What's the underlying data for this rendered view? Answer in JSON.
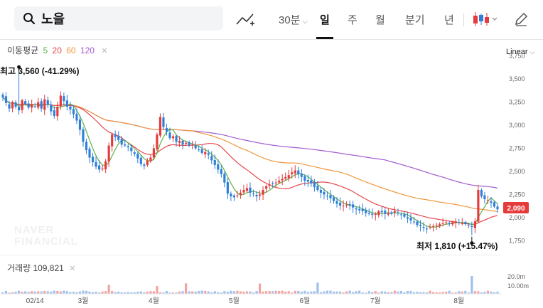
{
  "search": {
    "query": "노을"
  },
  "periods": [
    {
      "label": "30분",
      "active": false
    },
    {
      "label": "일",
      "active": true
    },
    {
      "label": "주",
      "active": false
    },
    {
      "label": "월",
      "active": false
    },
    {
      "label": "분기",
      "active": false
    },
    {
      "label": "년",
      "active": false
    }
  ],
  "icons": {
    "search": "search-icon",
    "draw": "trend-draw-icon",
    "candle": "candlestick-icon",
    "edit": "pencil-icon"
  },
  "colors": {
    "up": "#e63b3b",
    "down": "#2f7fd9",
    "ma5": "#5fb14c",
    "ma20": "#e6484b",
    "ma60": "#f0963c",
    "ma120": "#a05bd0",
    "price_badge": "#e63b3b"
  },
  "ma_legend": {
    "label": "이동평균",
    "periods": [
      "5",
      "20",
      "60",
      "120"
    ]
  },
  "scale_mode": "Linear",
  "current_price_badge": "2,090",
  "watermark": {
    "line1": "NAVER",
    "line2": "FINANCIAL"
  },
  "annotations": {
    "high": "최고 3,560 (-41.29%)",
    "low": "최저 1,810 (+15.47%)"
  },
  "volume": {
    "label": "거래량 109,821",
    "ticks": [
      "20.0m",
      "10.00m"
    ]
  },
  "chart_data": {
    "type": "candlestick",
    "y_ticks": [
      "3,750",
      "3,500",
      "3,250",
      "3,000",
      "2,750",
      "2,500",
      "2,250",
      "2,000",
      "1,750"
    ],
    "ylim": [
      1600,
      3800
    ],
    "x_tick_labels": [
      {
        "label": "02/14",
        "index": 10
      },
      {
        "label": "3월",
        "index": 25
      },
      {
        "label": "4월",
        "index": 47
      },
      {
        "label": "5월",
        "index": 72
      },
      {
        "label": "6월",
        "index": 94
      },
      {
        "label": "7월",
        "index": 116
      },
      {
        "label": "8월",
        "index": 142
      }
    ],
    "close": [
      3300,
      3240,
      3180,
      3250,
      3200,
      3160,
      3270,
      3230,
      3190,
      3220,
      3200,
      3250,
      3180,
      3280,
      3220,
      3150,
      3100,
      3200,
      3320,
      3260,
      3200,
      3170,
      3120,
      3050,
      2950,
      2820,
      2730,
      2650,
      2600,
      2550,
      2520,
      2530,
      2610,
      2780,
      2900,
      2870,
      2840,
      2790,
      2780,
      2760,
      2720,
      2690,
      2640,
      2580,
      2560,
      2620,
      2650,
      2750,
      2900,
      3090,
      2980,
      2930,
      2860,
      2880,
      2820,
      2830,
      2790,
      2810,
      2780,
      2790,
      2750,
      2730,
      2700,
      2710,
      2680,
      2620,
      2570,
      2520,
      2470,
      2380,
      2260,
      2230,
      2220,
      2240,
      2270,
      2300,
      2320,
      2270,
      2260,
      2230,
      2250,
      2300,
      2340,
      2360,
      2370,
      2380,
      2400,
      2420,
      2440,
      2460,
      2490,
      2510,
      2470,
      2440,
      2400,
      2390,
      2370,
      2330,
      2300,
      2270,
      2250,
      2230,
      2210,
      2180,
      2150,
      2130,
      2130,
      2140,
      2130,
      2110,
      2090,
      2080,
      2070,
      2050,
      2040,
      2030,
      2040,
      2070,
      2060,
      2040,
      2050,
      2040,
      2070,
      2050,
      2030,
      2010,
      1990,
      1970,
      1950,
      1920,
      1910,
      1890,
      1880,
      1900,
      1910,
      1920,
      1930,
      1940,
      1950,
      1930,
      1950,
      1960,
      1950,
      1940,
      1930,
      1920,
      1900,
      1960,
      2300,
      2230,
      2200,
      2190,
      2160,
      2120,
      2090
    ],
    "high_marker": {
      "value": 3560,
      "index": 5
    },
    "low_marker": {
      "value": 1810,
      "index": 146
    }
  }
}
